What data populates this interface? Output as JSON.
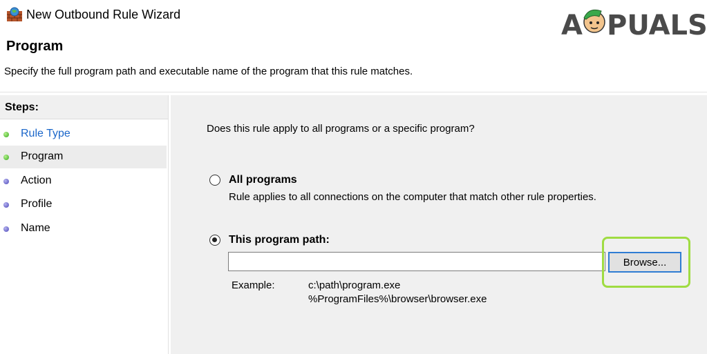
{
  "window": {
    "title": "New Outbound Rule Wizard"
  },
  "watermark": {
    "brand": "APPUALS"
  },
  "header": {
    "title": "Program",
    "description": "Specify the full program path and executable name of the program that this rule matches."
  },
  "steps": {
    "heading": "Steps:",
    "items": [
      {
        "label": "Rule Type",
        "status": "completed"
      },
      {
        "label": "Program",
        "status": "current"
      },
      {
        "label": "Action",
        "status": "pending"
      },
      {
        "label": "Profile",
        "status": "pending"
      },
      {
        "label": "Name",
        "status": "pending"
      }
    ]
  },
  "main": {
    "question": "Does this rule apply to all programs or a specific program?",
    "options": [
      {
        "label": "All programs",
        "description": "Rule applies to all connections on the computer that match other rule properties.",
        "selected": false
      },
      {
        "label": "This program path:",
        "selected": true
      }
    ],
    "path_value": "",
    "browse_label": "Browse...",
    "example_label": "Example:",
    "examples": [
      "c:\\path\\program.exe",
      "%ProgramFiles%\\browser\\browser.exe"
    ]
  },
  "colors": {
    "highlight": "#9fdc42",
    "link": "#1a66c9",
    "focus_border": "#2e7cd3"
  },
  "icons": {
    "app": "firewall-icon",
    "completed_step": "green-bullet-icon",
    "pending_step": "blue-bullet-icon"
  }
}
